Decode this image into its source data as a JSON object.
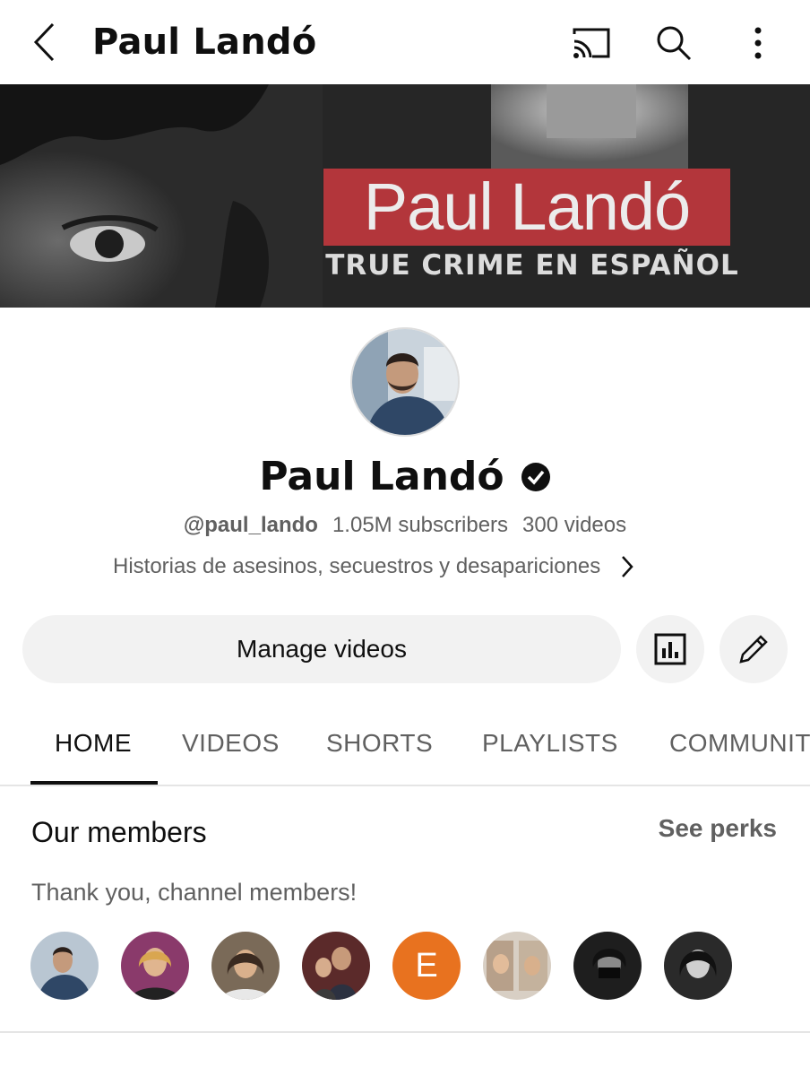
{
  "header": {
    "title": "Paul Landó",
    "back_icon": "chevron-left-icon",
    "cast_icon": "cast-icon",
    "search_icon": "search-icon",
    "more_icon": "more-vertical-icon"
  },
  "banner": {
    "title": "Paul Landó",
    "subtitle": "TRUE CRIME EN ESPAÑOL"
  },
  "channel": {
    "name": "Paul Landó",
    "handle": "@paul_lando",
    "subscribers": "1.05M subscribers",
    "videos": "300 videos",
    "description": "Historias de asesinos, secuestros y desapariciones"
  },
  "actions": {
    "manage_label": "Manage videos",
    "stats_icon": "analytics-icon",
    "edit_icon": "edit-pencil-icon"
  },
  "tabs": [
    {
      "label": "HOME",
      "active": true
    },
    {
      "label": "VIDEOS"
    },
    {
      "label": "SHORTS"
    },
    {
      "label": "PLAYLISTS"
    },
    {
      "label": "COMMUNIT"
    }
  ],
  "members": {
    "title": "Our members",
    "see_perks": "See perks",
    "thanks": "Thank you, channel members!",
    "letter_member": "E"
  },
  "colors": {
    "banner_red": "#b3363b",
    "member_orange": "#e8721f",
    "text_secondary": "#606060"
  }
}
